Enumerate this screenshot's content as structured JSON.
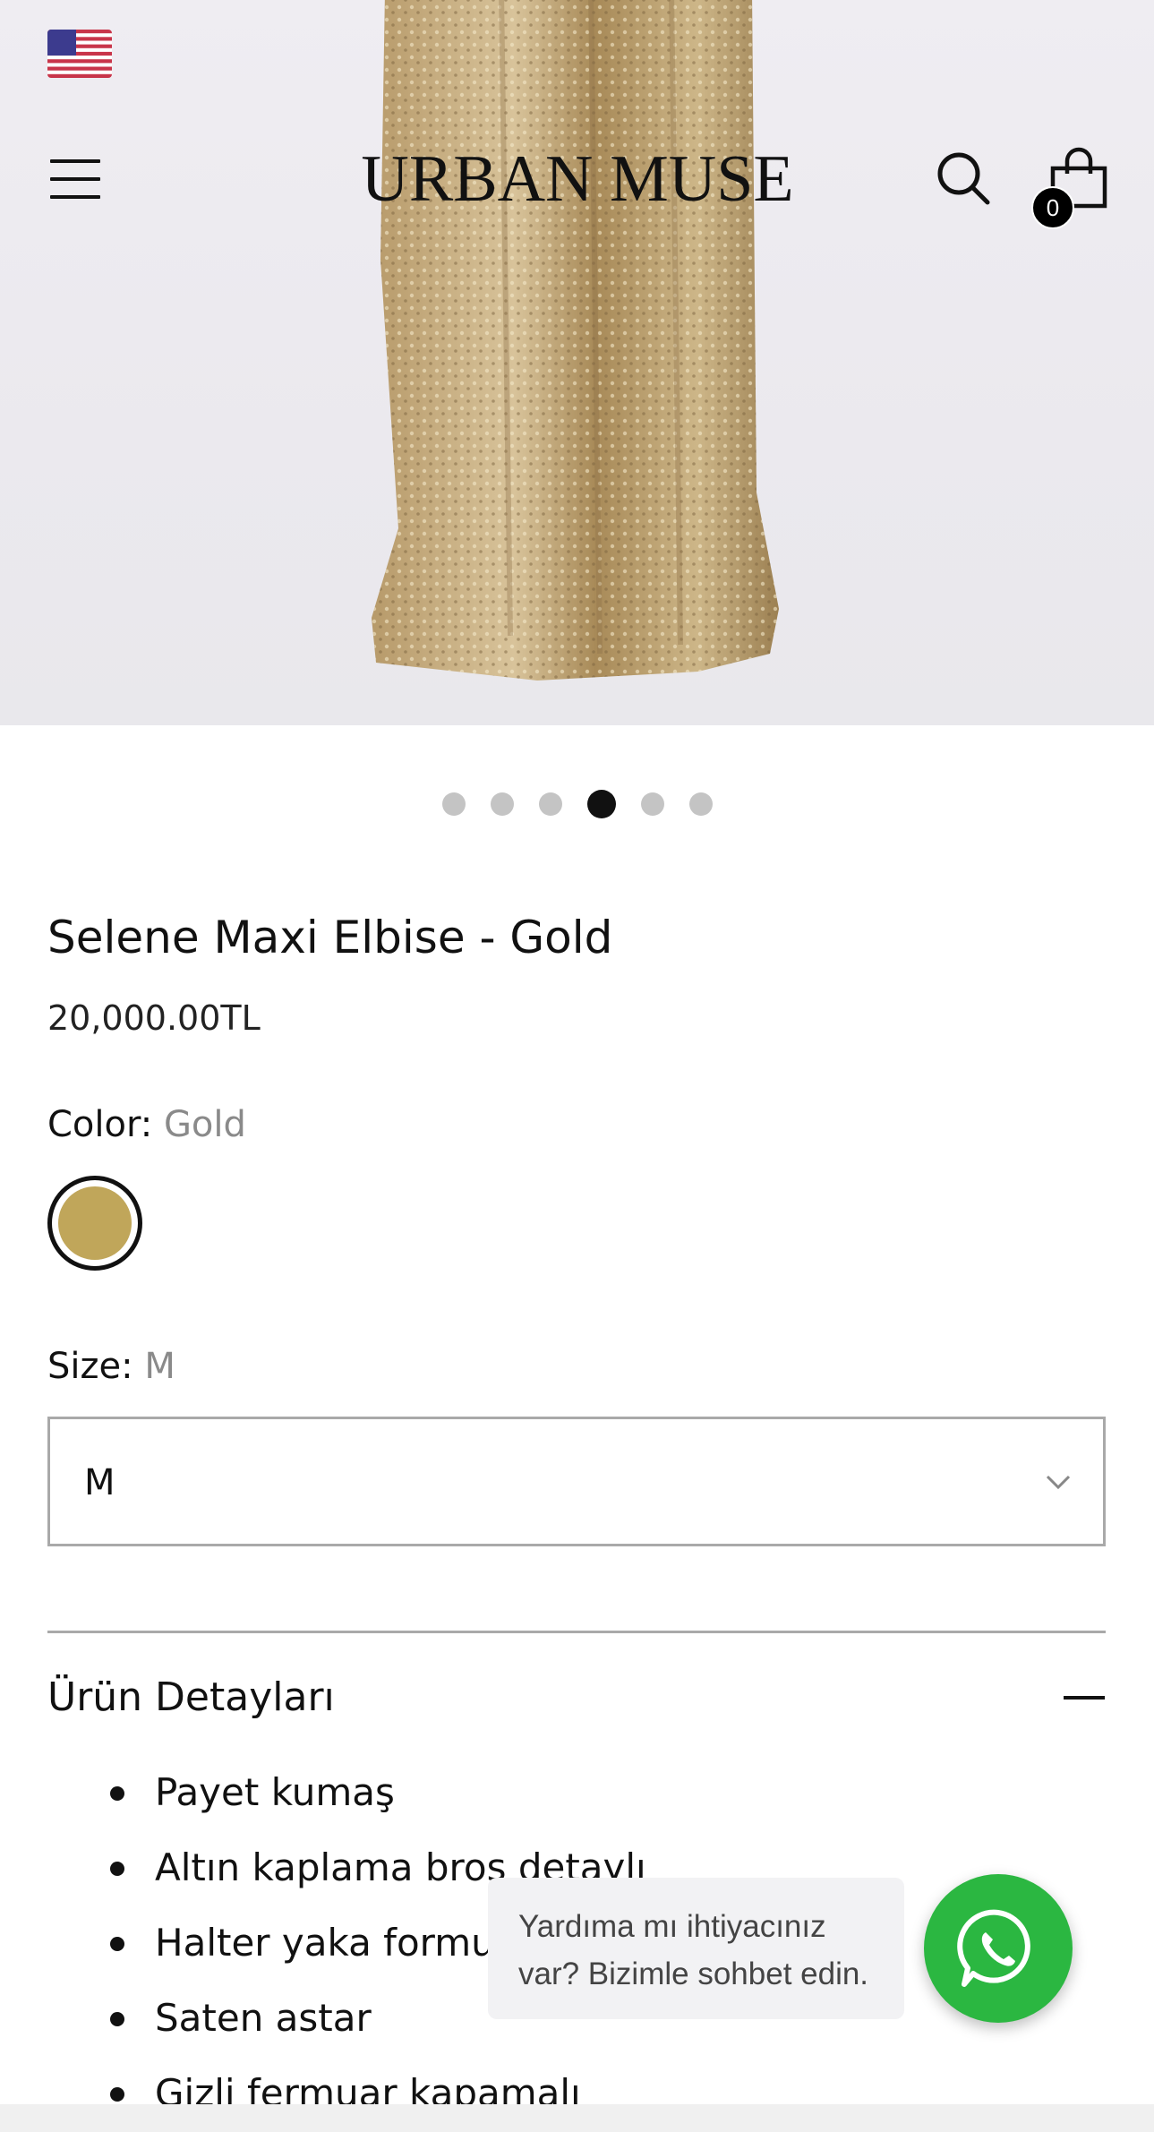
{
  "header": {
    "logo": "URBAN MUSE",
    "cart_count": "0",
    "flag_icon": "us-flag-icon"
  },
  "gallery": {
    "slides": 6,
    "active_slide": 4
  },
  "product": {
    "title": "Selene Maxi Elbise - Gold",
    "price": "20,000.00TL"
  },
  "color": {
    "label": "Color:",
    "value": "Gold",
    "swatch_hex": "#c0a65a"
  },
  "size": {
    "label": "Size:",
    "value": "M",
    "selected": "M"
  },
  "details": {
    "title": "Ürün Detayları",
    "items": [
      "Payet  kumaş",
      "Altın kaplama broş detaylı",
      "Halter yaka formu",
      "Saten astar",
      "Gizli fermuar kapamalı"
    ]
  },
  "chat": {
    "line1": "Yardıma mı ihtiyacınız",
    "line2": "var? Bizimle sohbet edin.",
    "button_color": "#2bb741"
  }
}
